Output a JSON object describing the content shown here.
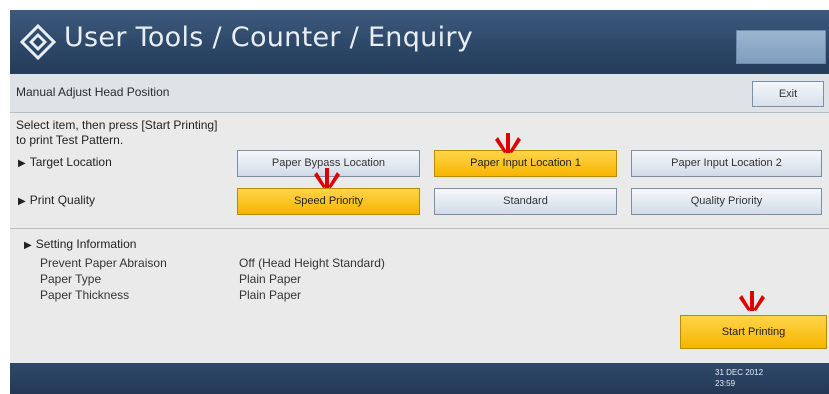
{
  "header": {
    "title": "User Tools / Counter / Enquiry",
    "logo_icon": "diamond-icon"
  },
  "subheader": {
    "title": "Manual Adjust Head Position",
    "exit_label": "Exit"
  },
  "main": {
    "instruction_line1": "Select item, then press [Start Printing]",
    "instruction_line2": "to print Test Pattern.",
    "target_location": {
      "label": "Target Location",
      "options": [
        "Paper Bypass Location",
        "Paper Input Location 1",
        "Paper Input Location 2"
      ],
      "selected": "Paper Input Location 1"
    },
    "print_quality": {
      "label": "Print Quality",
      "options": [
        "Speed Priority",
        "Standard",
        "Quality Priority"
      ],
      "selected": "Speed Priority"
    }
  },
  "setting_info": {
    "heading": "Setting Information",
    "rows": [
      {
        "label": "Prevent Paper Abraison",
        "value": "Off (Head Height Standard)"
      },
      {
        "label": "Paper Type",
        "value": "Plain Paper"
      },
      {
        "label": "Paper Thickness",
        "value": "Plain Paper"
      }
    ],
    "start_label": "Start Printing"
  },
  "footer": {
    "date": "31 DEC 2012",
    "time": "23:59"
  },
  "colors": {
    "header_bg": "#2c4667",
    "selected_button": "#f7b500",
    "marker_red": "#e00000"
  }
}
